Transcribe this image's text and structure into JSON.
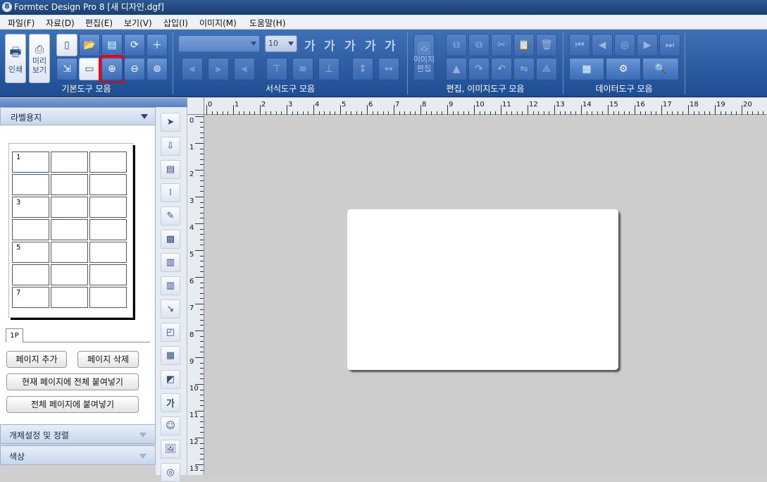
{
  "window": {
    "title": "Formtec Design Pro 8 [새 디자인.dgf]"
  },
  "menu": [
    "파일(F)",
    "자료(D)",
    "편집(E)",
    "보기(V)",
    "삽입(I)",
    "이미지(M)",
    "도움말(H)"
  ],
  "ribbon": {
    "groups": {
      "basic": "기본도구 모음",
      "format": "서식도구 모음",
      "edit": "편집, 이미지도구 모음",
      "data": "데이터도구 모음"
    },
    "print_label": "인쇄",
    "preview_label": "미리\n보기",
    "font_size": "10",
    "image_edit_label": "이미지\n편집"
  },
  "left_panel": {
    "title": "라벨용지",
    "cells": [
      "1",
      "",
      "",
      "",
      "",
      "",
      "3",
      "",
      "",
      "",
      "",
      "",
      "5",
      "",
      "",
      "",
      "",
      "",
      "7",
      "",
      ""
    ],
    "page_tab": "1P",
    "buttons": {
      "add_page": "페이지 추가",
      "delete_page": "페이지 삭제",
      "paste_all_current": "현재 페이지에 전체 붙여넣기",
      "paste_all_pages": "전체 페이지에 붙여넣기"
    },
    "sections": {
      "object_settings": "개체설정 및 정렬",
      "color": "색상"
    }
  },
  "ruler": {
    "top": [
      "0",
      "1",
      "2",
      "3",
      "4",
      "5",
      "6",
      "7",
      "8",
      "9",
      "10",
      "11",
      "12",
      "13",
      "14",
      "15",
      "16",
      "17",
      "18",
      "19",
      "20"
    ],
    "left": [
      "0",
      "1",
      "2",
      "3",
      "4",
      "5",
      "6",
      "7",
      "8",
      "9",
      "10",
      "11",
      "12",
      "13"
    ]
  }
}
